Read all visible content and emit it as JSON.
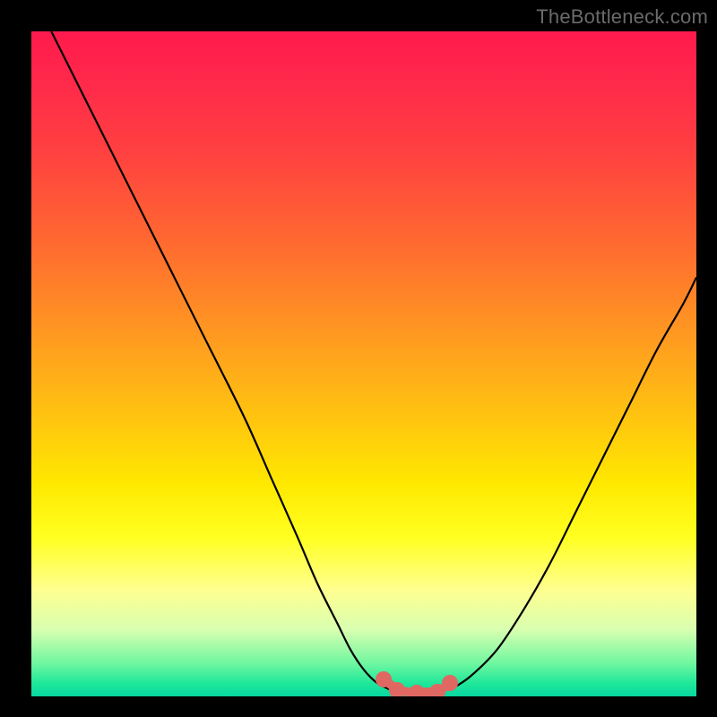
{
  "attribution": "TheBottleneck.com",
  "chart_data": {
    "type": "line",
    "title": "",
    "xlabel": "",
    "ylabel": "",
    "x_range": [
      0,
      100
    ],
    "y_range": [
      0,
      100
    ],
    "series": [
      {
        "name": "left-branch",
        "x": [
          3,
          8,
          14,
          20,
          26,
          32,
          36,
          40,
          43,
          46,
          48,
          50,
          52,
          54
        ],
        "y": [
          100,
          90,
          78,
          66,
          54,
          42,
          33,
          24,
          17,
          11,
          7,
          4,
          2,
          1
        ]
      },
      {
        "name": "right-branch",
        "x": [
          63,
          66,
          70,
          74,
          78,
          82,
          86,
          90,
          94,
          98,
          100
        ],
        "y": [
          1,
          3,
          7,
          13,
          20,
          28,
          36,
          44,
          52,
          59,
          63
        ]
      }
    ],
    "highlight_segment": {
      "name": "optimal-range",
      "points": [
        {
          "x": 53,
          "y": 2.5
        },
        {
          "x": 55,
          "y": 1.0
        },
        {
          "x": 58,
          "y": 0.5
        },
        {
          "x": 61,
          "y": 0.7
        },
        {
          "x": 63,
          "y": 2.0
        }
      ],
      "color": "#e06862"
    },
    "background_gradient": {
      "top": "#ff1a4d",
      "mid": "#ffe800",
      "bottom": "#20e89a"
    }
  }
}
